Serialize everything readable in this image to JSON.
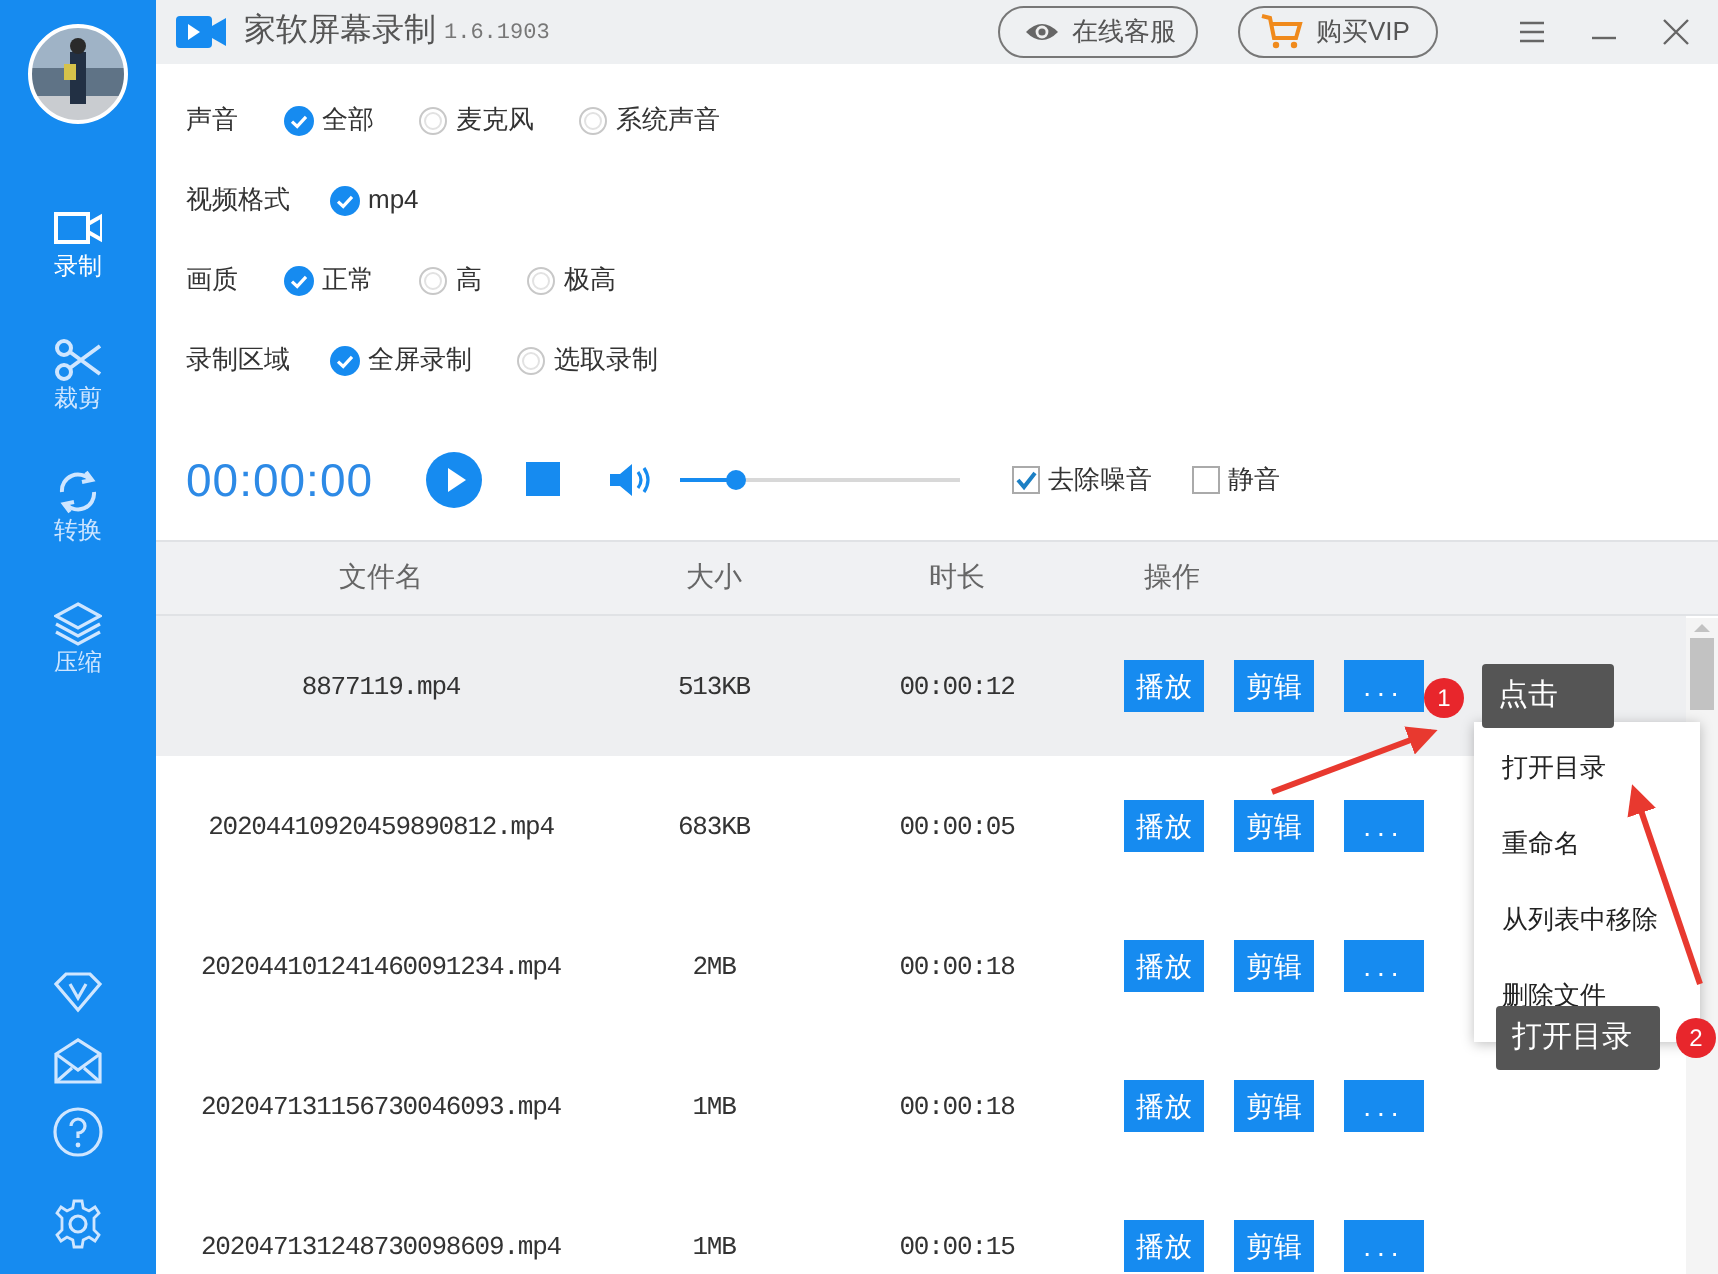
{
  "app": {
    "title": "家软屏幕录制",
    "version": "1.6.1903"
  },
  "header_buttons": [
    {
      "kind": "service",
      "label": "在线客服"
    },
    {
      "kind": "vip",
      "label": "购买VIP"
    }
  ],
  "sidebar": {
    "items": [
      {
        "kind": "record",
        "label": "录制",
        "selected": true
      },
      {
        "kind": "cut",
        "label": "裁剪",
        "selected": false
      },
      {
        "kind": "convert",
        "label": "转换",
        "selected": false
      },
      {
        "kind": "compress",
        "label": "压缩",
        "selected": false
      }
    ]
  },
  "settings": [
    {
      "label": "声音",
      "options": [
        {
          "label": "全部",
          "selected": true
        },
        {
          "label": "麦克风",
          "selected": false
        },
        {
          "label": "系统声音",
          "selected": false
        }
      ]
    },
    {
      "label": "视频格式",
      "options": [
        {
          "label": "mp4",
          "selected": true
        }
      ]
    },
    {
      "label": "画质",
      "options": [
        {
          "label": "正常",
          "selected": true
        },
        {
          "label": "高",
          "selected": false
        },
        {
          "label": "极高",
          "selected": false
        }
      ]
    },
    {
      "label": "录制区域",
      "options": [
        {
          "label": "全屏录制",
          "selected": true
        },
        {
          "label": "选取录制",
          "selected": false
        }
      ]
    }
  ],
  "recorder": {
    "time": "00:00:00",
    "volume": {
      "level": 0.2
    },
    "checkboxes": [
      {
        "label": "去除噪音",
        "checked": true
      },
      {
        "label": "静音",
        "checked": false
      }
    ]
  },
  "table": {
    "columns": [
      "文件名",
      "大小",
      "时长",
      "操作"
    ],
    "rows": [
      {
        "name": "8877119.mp4",
        "size": "513KB",
        "duration": "00:00:12",
        "selected": true,
        "actions": [
          "播放",
          "剪辑",
          "..."
        ]
      },
      {
        "name": "20204410920459890812.mp4",
        "size": "683KB",
        "duration": "00:00:05",
        "selected": false,
        "actions": [
          "播放",
          "剪辑",
          "..."
        ]
      },
      {
        "name": "202044101241460091234.mp4",
        "size": "2MB",
        "duration": "00:00:18",
        "selected": false,
        "actions": [
          "播放",
          "剪辑",
          "..."
        ]
      },
      {
        "name": "202047131156730046093.mp4",
        "size": "1MB",
        "duration": "00:00:18",
        "selected": false,
        "actions": [
          "播放",
          "剪辑",
          "..."
        ]
      },
      {
        "name": "202047131248730098609.mp4",
        "size": "1MB",
        "duration": "00:00:15",
        "selected": false,
        "actions": [
          "播放",
          "剪辑",
          "..."
        ]
      }
    ]
  },
  "context_menu": {
    "items": [
      "打开目录",
      "重命名",
      "从列表中移除",
      "删除文件"
    ]
  },
  "annotations": [
    {
      "badge": "1",
      "tip": "点击"
    },
    {
      "badge": "2",
      "tip": "打开目录"
    }
  ]
}
